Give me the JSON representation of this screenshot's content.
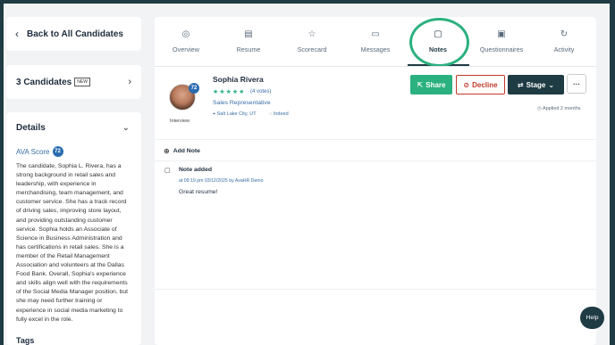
{
  "nav": {
    "back_label": "Back to All Candidates",
    "candidates_label": "3 Candidates",
    "new_badge": "NEW"
  },
  "details": {
    "title": "Details",
    "ava_label": "AVA Score",
    "ava_score": "72",
    "summary": "The candidate, Sophia L. Rivera, has a strong background in retail sales and leadership, with experience in merchandising, team management, and customer service. She has a track record of driving sales, improving store layout, and providing outstanding customer service. Sophia holds an Associate of Science in Business Administration and has certifications in retail sales. She is a member of the Retail Management Association and volunteers at the Dallas Food Bank. Overall, Sophia's experience and skills align well with the requirements of the Social Media Manager position, but she may need further training or experience in social media marketing to fully excel in the role.",
    "tags_label": "Tags"
  },
  "tabs": [
    {
      "label": "Overview",
      "icon": "user-circle-icon"
    },
    {
      "label": "Resume",
      "icon": "document-icon"
    },
    {
      "label": "Scorecard",
      "icon": "star-icon"
    },
    {
      "label": "Messages",
      "icon": "chat-icon"
    },
    {
      "label": "Notes",
      "icon": "note-icon",
      "active": true
    },
    {
      "label": "Questionnaires",
      "icon": "clipboard-icon"
    },
    {
      "label": "Activity",
      "icon": "refresh-icon"
    }
  ],
  "candidate": {
    "name": "Sophia Rivera",
    "score_badge": "72",
    "stage_caption": "Interview",
    "rating_stars": 5,
    "votes": "(4 votes)",
    "role": "Sales Representative",
    "location": "Salt Lake City, UT",
    "source": "Indeed",
    "applied": "Applied 2 months"
  },
  "actions": {
    "share": "Share",
    "decline": "Decline",
    "stage": "Stage",
    "more": "···"
  },
  "notes": {
    "add_label": "Add Note",
    "items": [
      {
        "title": "Note added",
        "meta": "at 09:19 pm 03/12/2025 by AvaHR Demo",
        "body": "Great resume!"
      }
    ]
  },
  "help_label": "Help",
  "colors": {
    "brand_dark": "#1f3b44",
    "accent_green": "#2bb07f",
    "link_blue": "#3a6ea5",
    "decline_red": "#c0392b"
  }
}
